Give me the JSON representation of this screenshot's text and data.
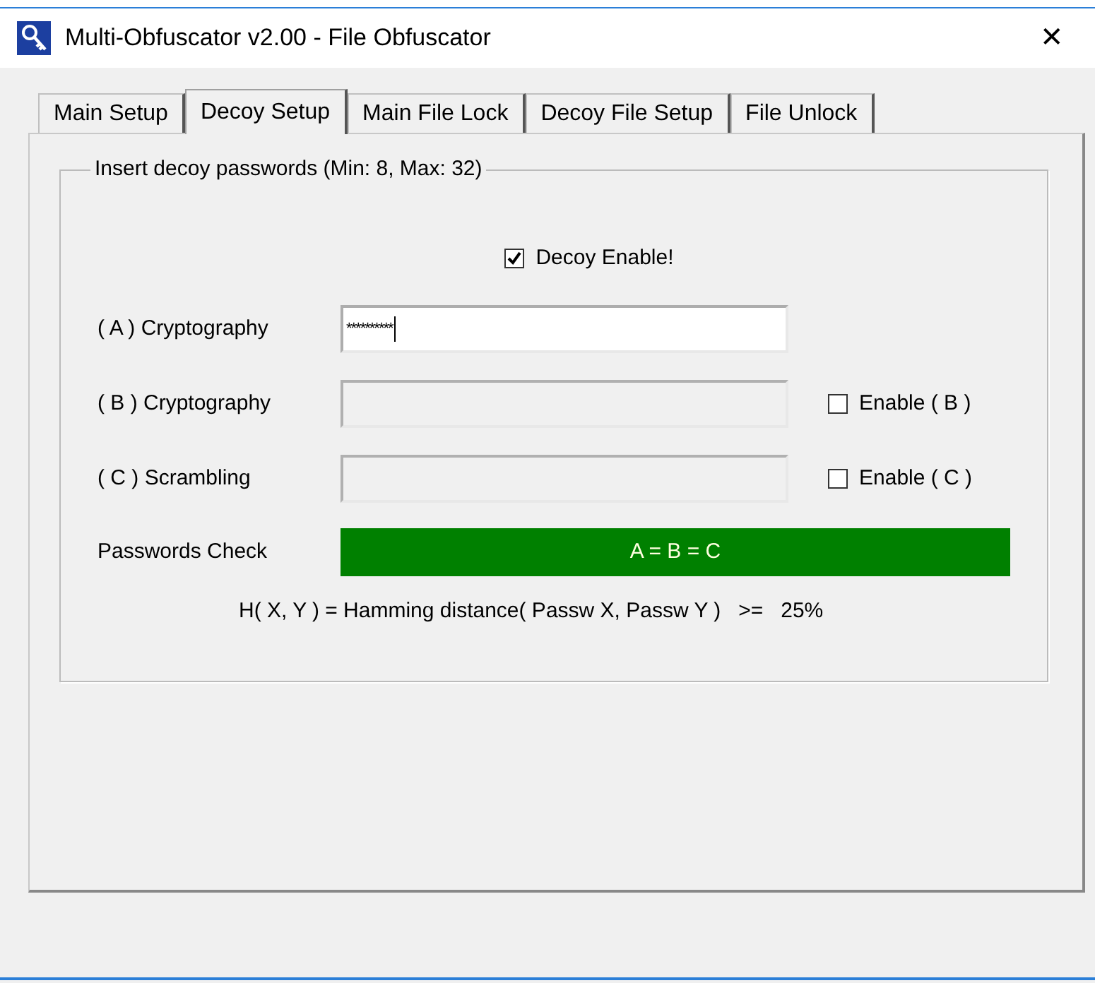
{
  "window": {
    "title": "Multi-Obfuscator v2.00 - File Obfuscator",
    "close": "✕"
  },
  "tabs": [
    {
      "label": "Main Setup",
      "selected": false
    },
    {
      "label": "Decoy Setup",
      "selected": true
    },
    {
      "label": "Main File Lock",
      "selected": false
    },
    {
      "label": "Decoy File Setup",
      "selected": false
    },
    {
      "label": "File Unlock",
      "selected": false
    }
  ],
  "group": {
    "title": "Insert decoy passwords (Min: 8, Max: 32)",
    "decoy_enable": {
      "label": "Decoy Enable!",
      "checked": true
    },
    "passwords": [
      {
        "label": "( A ) Cryptography",
        "value": "**********",
        "disabled": false,
        "focused": true
      },
      {
        "label": "( B ) Cryptography",
        "disabled": true,
        "focused": false,
        "enable": {
          "label": "Enable ( B )",
          "checked": false
        }
      },
      {
        "label": "( C ) Scrambling",
        "disabled": true,
        "focused": false,
        "enable": {
          "label": "Enable ( C )",
          "checked": false
        }
      }
    ],
    "check": {
      "label": "Passwords Check",
      "result": "A = B = C",
      "color": "#008000"
    },
    "formula": "H( X, Y ) = Hamming distance( Passw X, Passw Y )   >=   25%"
  }
}
